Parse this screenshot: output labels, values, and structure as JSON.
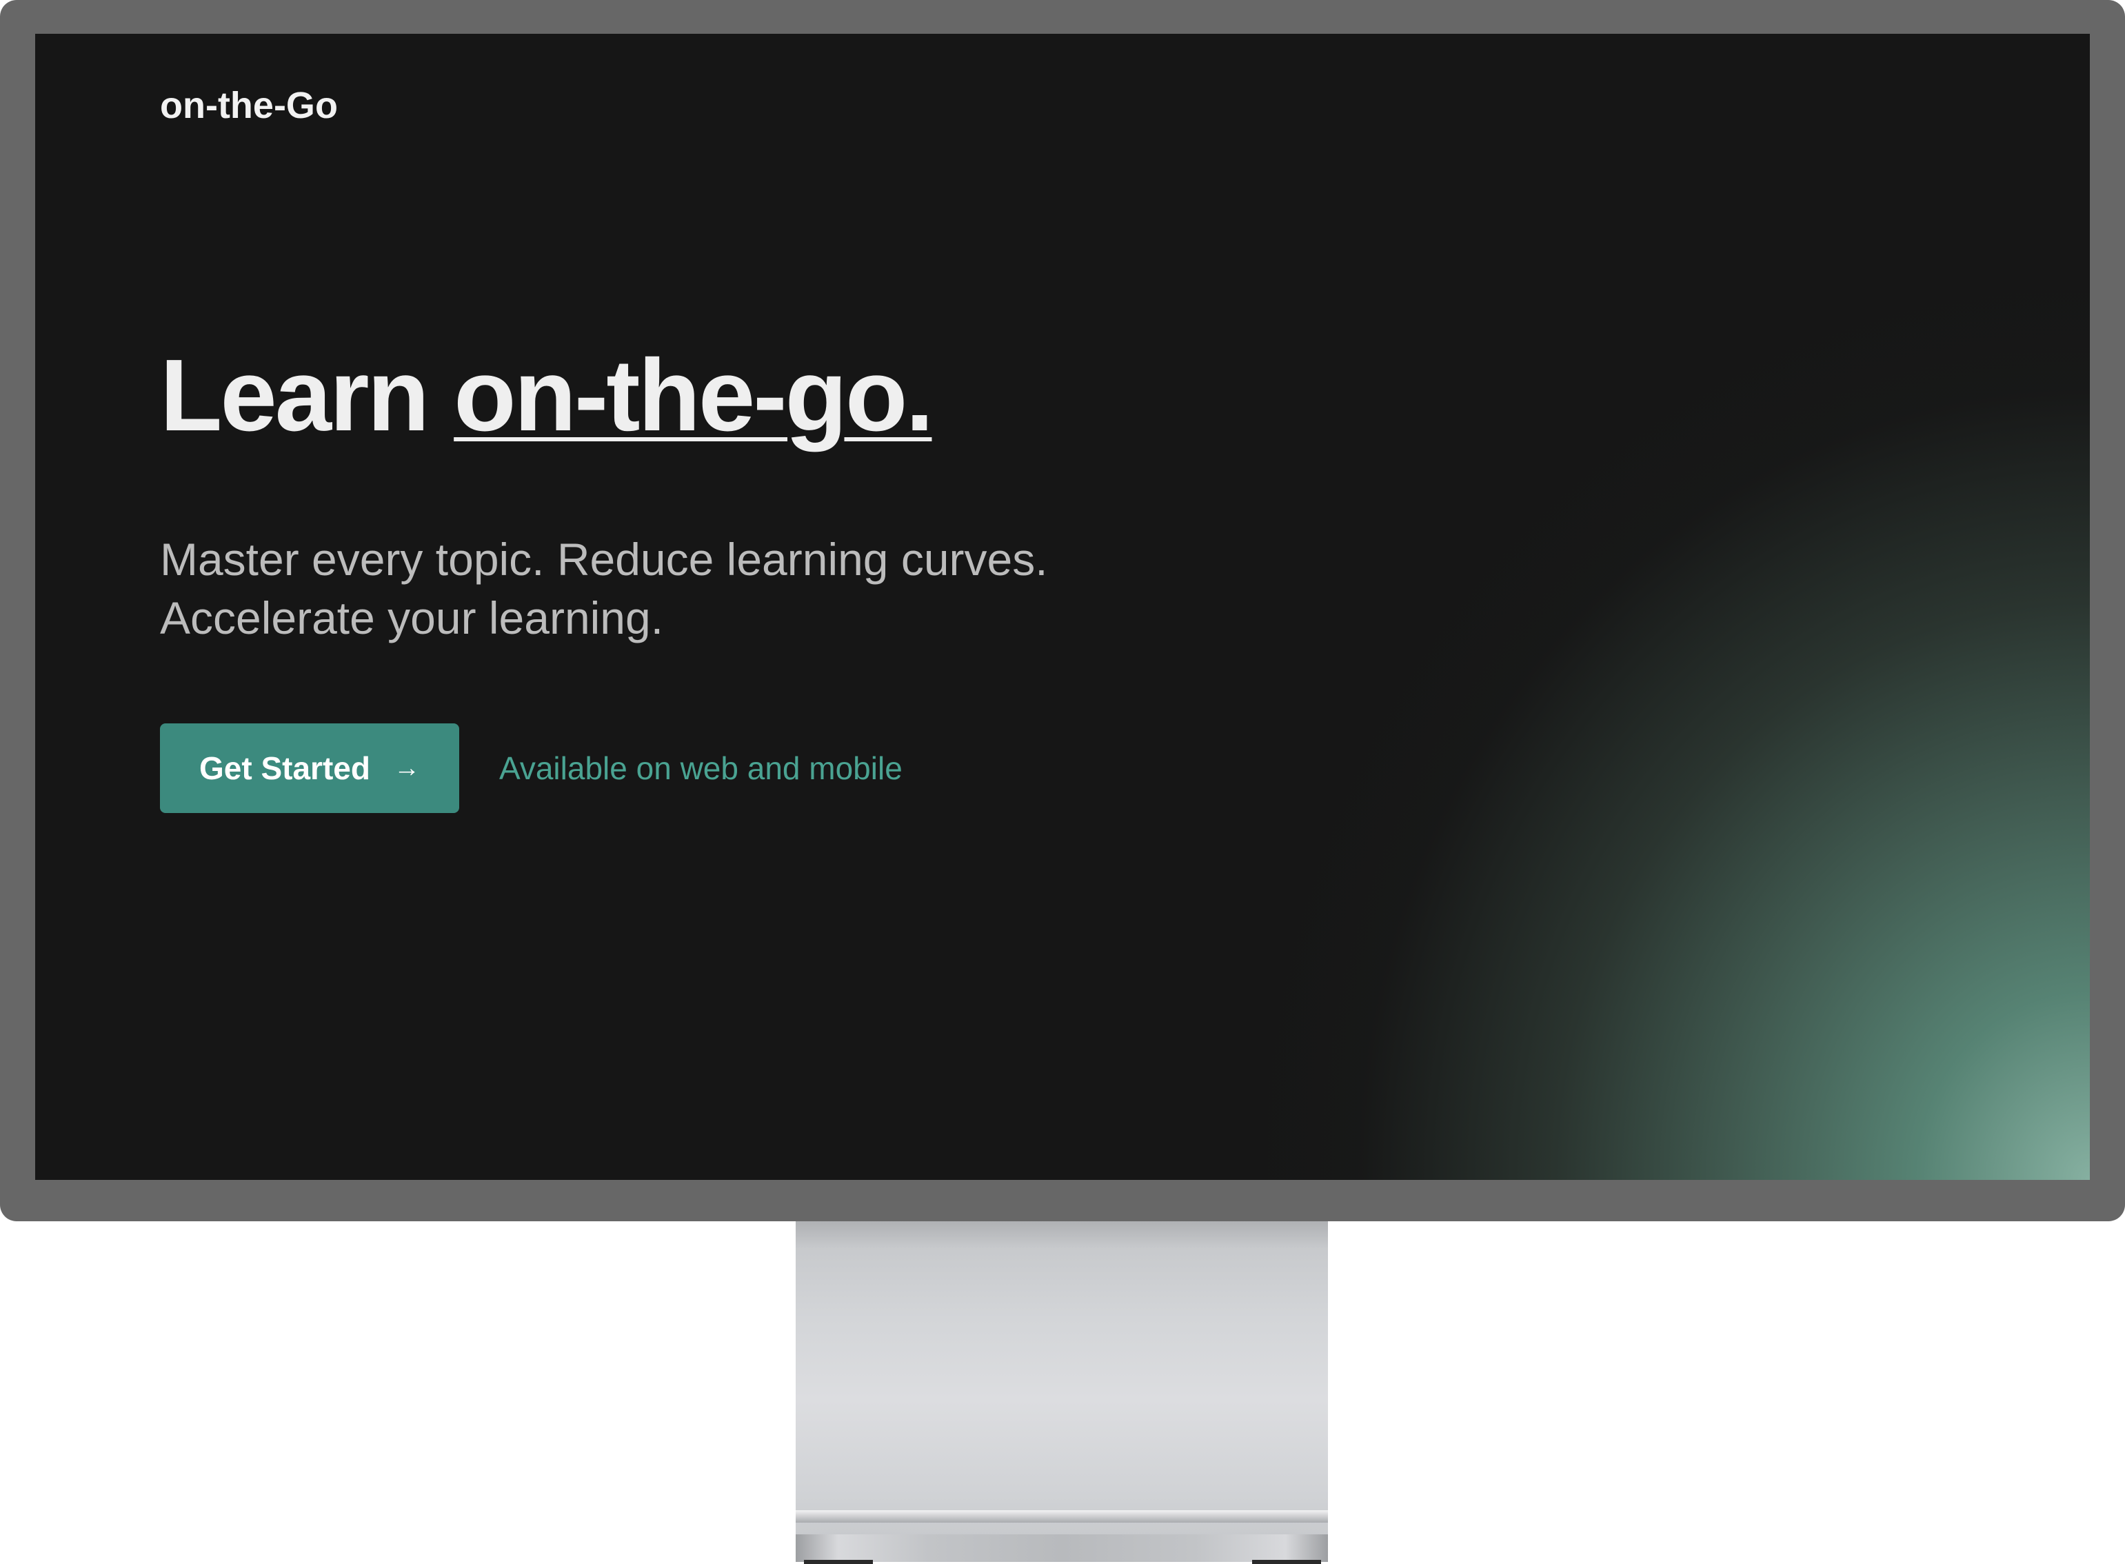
{
  "brand": {
    "name": "on-the-Go"
  },
  "hero": {
    "headline_prefix": "Learn",
    "headline_accent": "on-the-go.",
    "subheadline_line1": "Master every topic. Reduce learning curves.",
    "subheadline_line2": "Accelerate your learning."
  },
  "cta": {
    "button_label": "Get Started",
    "button_icon": "arrow-right-icon",
    "availability_text": "Available on web and mobile"
  },
  "colors": {
    "screen_background": "#161616",
    "accent": "#3c8a7e",
    "accent_text": "#4aa392",
    "glow": "#8cb8a8",
    "bezel": "#676767"
  }
}
